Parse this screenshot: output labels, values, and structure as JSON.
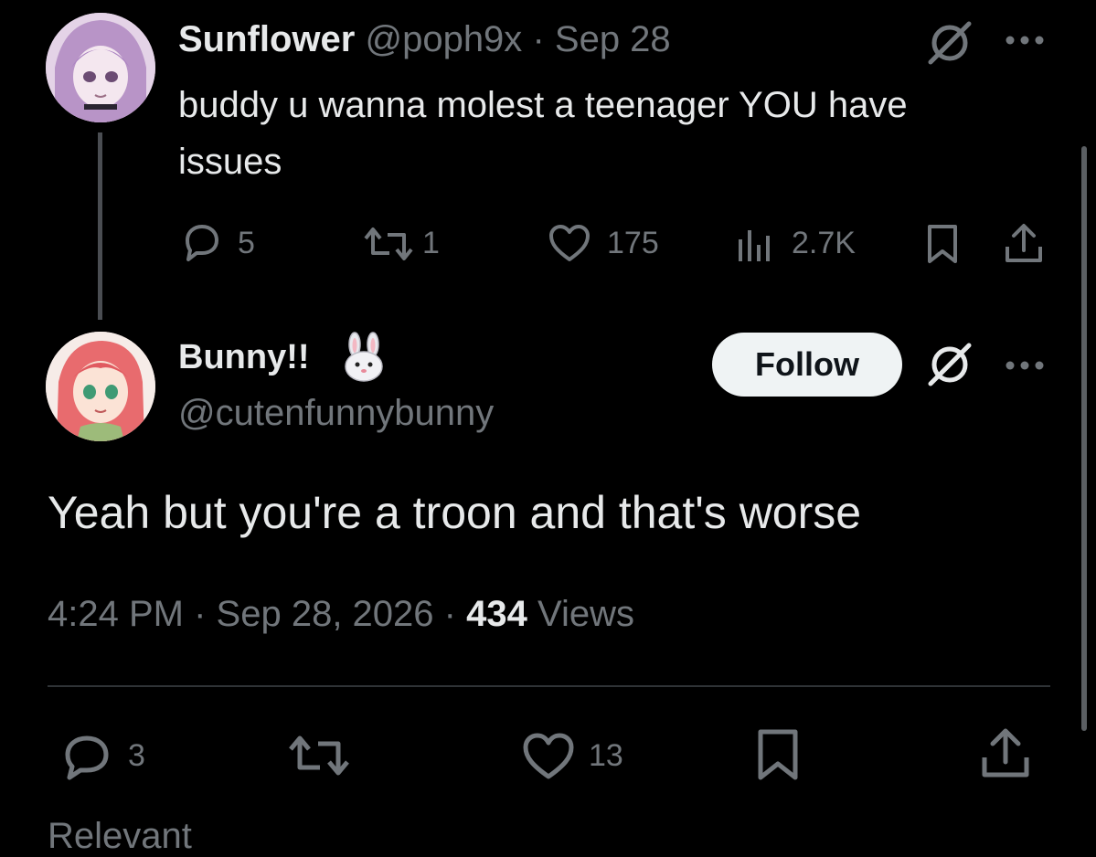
{
  "reply_tweet": {
    "display_name": "Sunflower",
    "handle": "@poph9x",
    "separator": "·",
    "date": "Sep 28",
    "text": "buddy u wanna molest a teenager YOU have issues",
    "replies": "5",
    "reposts": "1",
    "likes": "175",
    "views": "2.7K"
  },
  "main_tweet": {
    "display_name": "Bunny!!",
    "handle": "@cutenfunnybunny",
    "follow_label": "Follow",
    "text": "Yeah but you're a troon and that's worse",
    "time": "4:24 PM",
    "separator": "·",
    "date": "Sep 28, 2026",
    "separator2": "·",
    "view_count": "434",
    "views_label": "Views",
    "replies": "3",
    "likes": "13"
  },
  "footer_partial_text": "Relevant",
  "colors": {
    "background": "#000000",
    "text": "#e7e9ea",
    "muted": "#71767b",
    "divider": "#2f3336",
    "follow_bg": "#eff3f4"
  }
}
